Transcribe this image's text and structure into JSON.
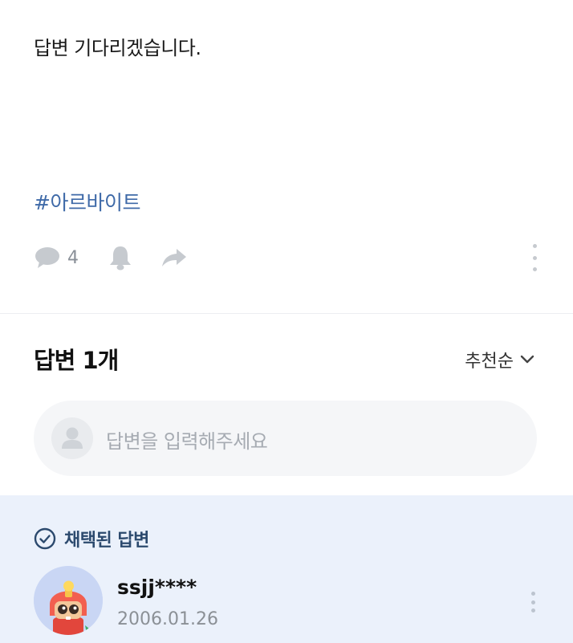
{
  "question": {
    "body": "답변 기다리겠습니다.",
    "hashtag": "#아르바이트"
  },
  "actions": {
    "comment_icon": "speech-bubble-icon",
    "comment_count": "4",
    "bell_icon": "bell-icon",
    "share_icon": "share-arrow-icon",
    "more_icon": "vertical-dots-icon"
  },
  "answers": {
    "title": "답변 1개",
    "sort_label": "추천순",
    "sort_icon": "chevron-down-icon",
    "input_placeholder": "답변을 입력해주세요"
  },
  "accepted_answer": {
    "badge_label": "채택된 답변",
    "badge_icon": "check-circle-icon",
    "author_name": "ssjj****",
    "date": "2006.01.26"
  },
  "colors": {
    "hashtag": "#3f6aa8",
    "accepted_background": "#ebf1fb",
    "accepted_label": "#2c4a6e",
    "muted_icon": "#c6cacf"
  }
}
